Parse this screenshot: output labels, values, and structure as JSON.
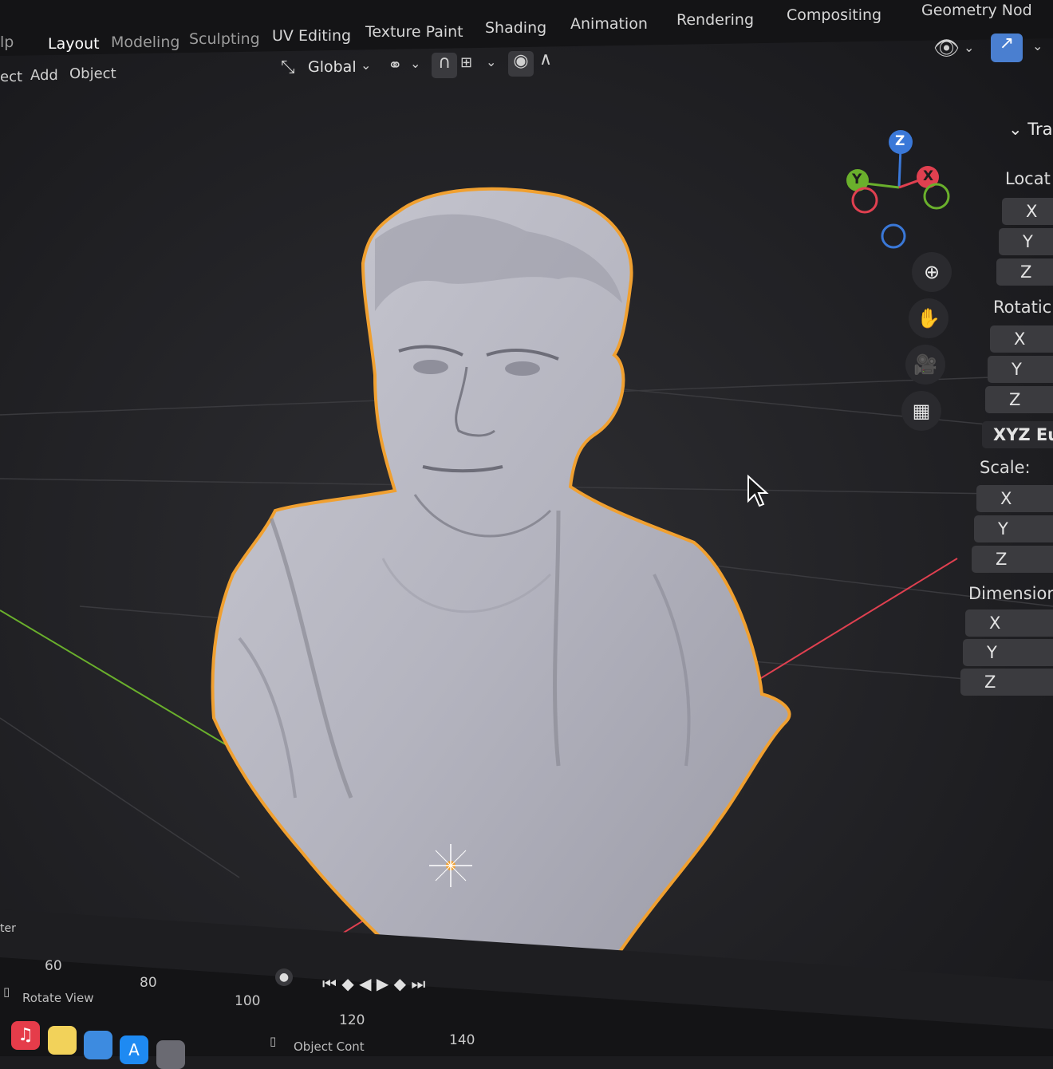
{
  "workspace_tabs": [
    "lp",
    "Layout",
    "Modeling",
    "Sculpting",
    "UV Editing",
    "Texture Paint",
    "Shading",
    "Animation",
    "Rendering",
    "Compositing",
    "Geometry Nod"
  ],
  "header_menu": {
    "select": "ect",
    "add": "Add",
    "object": "Object"
  },
  "transform": {
    "orientation": "Global"
  },
  "gizmo": {
    "z": "Z",
    "y": "Y",
    "x": "X"
  },
  "properties": {
    "section": "Tra",
    "location": {
      "label": "Locat",
      "x": "X",
      "y": "Y",
      "z": "Z"
    },
    "rotation": {
      "label": "Rotatic",
      "x": "X",
      "y": "Y",
      "z": "Z",
      "mode": "XYZ Eu"
    },
    "scale": {
      "label": "Scale:",
      "x": "X",
      "y": "Y",
      "z": "Z"
    },
    "dimensions": {
      "label": "Dimensior",
      "x": "X",
      "y": "Y",
      "z": "Z"
    }
  },
  "timeline": {
    "editor_label": "ter",
    "frames": [
      "60",
      "80",
      "100",
      "120",
      "140"
    ],
    "status_rotate": "Rotate View",
    "status_object": "Object Cont"
  },
  "colors": {
    "background": "#1c1c1f",
    "selection_outline": "#f0a030",
    "axis_x": "#e04050",
    "axis_y": "#6ab02c",
    "axis_z": "#3a78d8"
  }
}
